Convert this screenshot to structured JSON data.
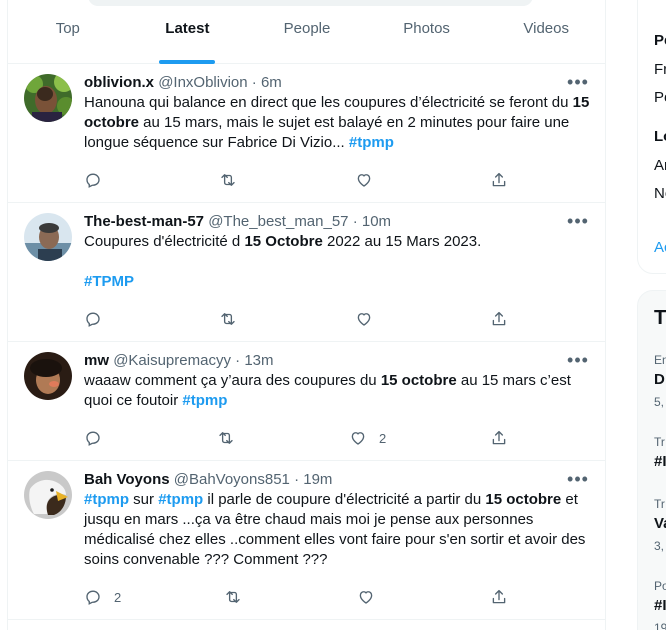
{
  "tabs": [
    {
      "label": "Top",
      "active": false
    },
    {
      "label": "Latest",
      "active": true
    },
    {
      "label": "People",
      "active": false
    },
    {
      "label": "Photos",
      "active": false
    },
    {
      "label": "Videos",
      "active": false
    }
  ],
  "colors": {
    "accent": "#1d9bf0",
    "text": "#0f1419",
    "muted": "#536471",
    "border": "#eff3f4"
  },
  "more_glyph": "•••",
  "tweets": [
    {
      "name": "oblivion.x",
      "handle": "@InxOblivion",
      "time": "6m",
      "segments": [
        {
          "t": "Hanouna qui balance en direct que les coupures d’électricité se feront du "
        },
        {
          "t": "15 octobre",
          "b": true
        },
        {
          "t": " au 15 mars, mais le sujet est balayé en 2 minutes pour faire une longue séquence sur Fabrice Di Vizio... "
        },
        {
          "t": "#tpmp",
          "tag": true
        }
      ],
      "reply_count": "",
      "like_count": ""
    },
    {
      "name": "The-best-man-57",
      "handle": "@The_best_man_57",
      "time": "10m",
      "segments": [
        {
          "t": "Coupures d'électricité d "
        },
        {
          "t": "15 Octobre",
          "b": true
        },
        {
          "t": " 2022 au 15 Mars 2023."
        },
        {
          "br": true
        },
        {
          "br": true
        },
        {
          "t": "#TPMP",
          "tag": true
        }
      ],
      "reply_count": "",
      "like_count": ""
    },
    {
      "name": "mw",
      "handle": "@Kaisupremacyy",
      "time": "13m",
      "segments": [
        {
          "t": "waaaw comment ça y’aura des coupures du "
        },
        {
          "t": "15 octobre",
          "b": true
        },
        {
          "t": " au 15 mars c’est quoi ce foutoir "
        },
        {
          "t": "#tpmp",
          "tag": true
        }
      ],
      "reply_count": "",
      "like_count": "2"
    },
    {
      "name": "Bah Voyons",
      "handle": "@BahVoyons851",
      "time": "19m",
      "segments": [
        {
          "t": "#tpmp",
          "tag": true
        },
        {
          "t": " sur "
        },
        {
          "t": "#tpmp",
          "tag": true
        },
        {
          "t": " il parle de coupure d'électricité a partir du "
        },
        {
          "t": "15 octobre",
          "b": true
        },
        {
          "t": " et jusqu en mars ...ça va être chaud mais moi je pense aux personnes médicalisé chez elles ..comment elles vont faire pour s'en sortir et avoir des soins convenable ??? Comment ???"
        }
      ],
      "reply_count": "2",
      "like_count": ""
    }
  ],
  "right_sidebar": {
    "card1_lines": [
      "Pe",
      "Fr",
      "Pe",
      "Lo",
      "Ar",
      "No",
      "Ac"
    ],
    "card2_title": "T",
    "card2_lines": [
      "En",
      "D",
      "5,",
      "Tr",
      "#I",
      "Tr",
      "Va",
      "3,",
      "Po",
      "#I",
      "19"
    ]
  }
}
